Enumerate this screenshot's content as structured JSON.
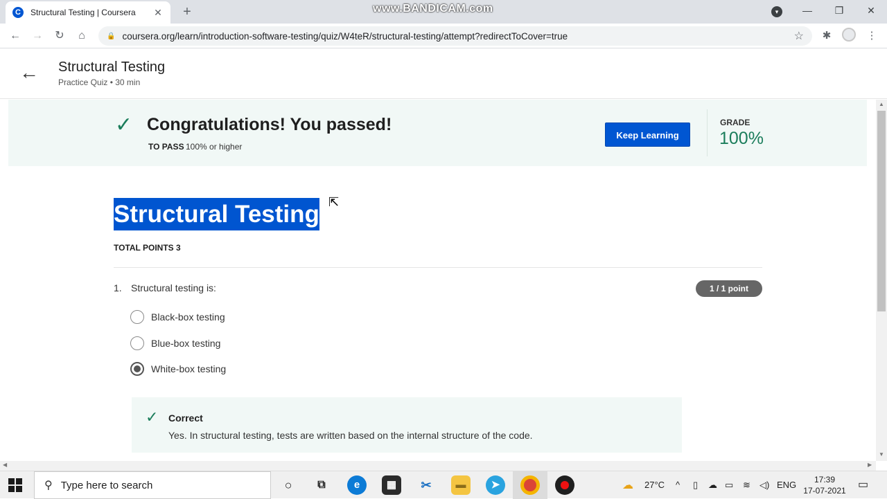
{
  "browser": {
    "tab_title": "Structural Testing | Coursera",
    "tab_favicon": "C",
    "watermark": "www.BANDICAM.com",
    "url": "coursera.org/learn/introduction-software-testing/quiz/W4teR/structural-testing/attempt?redirectToCover=true"
  },
  "header": {
    "title": "Structural Testing",
    "subtitle": "Practice Quiz • 30 min"
  },
  "banner": {
    "message": "Congratulations! You passed!",
    "to_pass_label": "TO PASS",
    "to_pass_value": "100% or higher",
    "button_label": "Keep Learning",
    "grade_label": "GRADE",
    "grade_value": "100%"
  },
  "quiz": {
    "title": "Structural Testing",
    "total_points": "TOTAL POINTS 3",
    "question": {
      "number": "1.",
      "text": "Structural testing is:",
      "points": "1 / 1 point",
      "options": [
        {
          "label": "Black-box testing",
          "selected": false
        },
        {
          "label": "Blue-box testing",
          "selected": false
        },
        {
          "label": "White-box testing",
          "selected": true
        }
      ],
      "feedback_title": "Correct",
      "feedback_text": "Yes. In structural testing, tests are written based on the internal structure of the code."
    }
  },
  "taskbar": {
    "search_placeholder": "Type here to search",
    "temperature": "27°C",
    "language": "ENG",
    "time": "17:39",
    "date": "17-07-2021"
  },
  "colors": {
    "accent": "#0056d2",
    "success": "#1b7d5b",
    "banner_bg": "#f1f8f6"
  }
}
